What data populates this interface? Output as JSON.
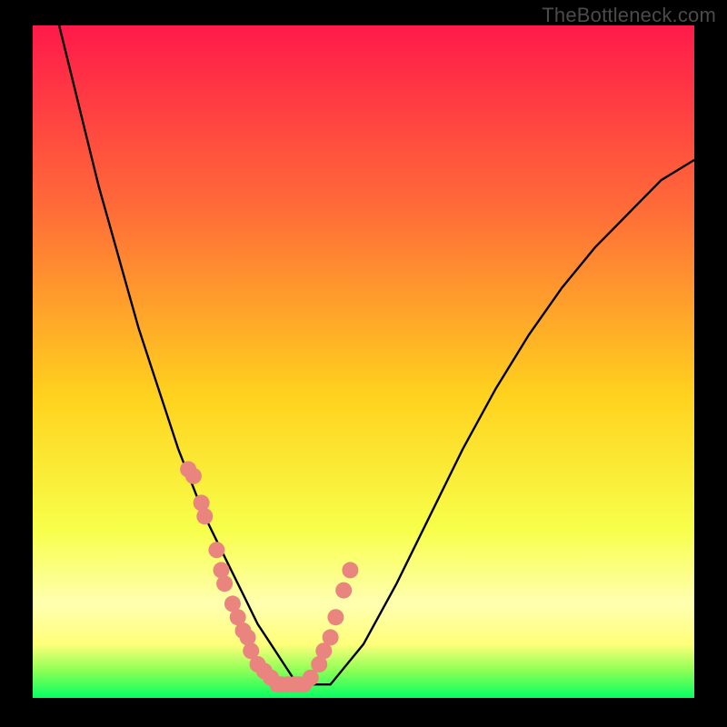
{
  "watermark": "TheBottleneck.com",
  "colors": {
    "frame": "#000000",
    "curve": "#000000",
    "dot_fill": "#e9847e",
    "grad_top": "#ff1a4a",
    "grad_mid_upper": "#ff6e38",
    "grad_mid": "#ffd21e",
    "grad_mid_lower": "#f7ff4a",
    "grad_band": "#ffffb0",
    "grad_bottom": "#05ff63"
  },
  "chart_data": {
    "type": "line",
    "title": "",
    "xlabel": "",
    "ylabel": "",
    "xlim": [
      0,
      100
    ],
    "ylim": [
      0,
      100
    ],
    "series": [
      {
        "name": "bottleneck-curve",
        "x": [
          4,
          6,
          8,
          10,
          12,
          14,
          16,
          18,
          20,
          22,
          24,
          26,
          28,
          30,
          32,
          34,
          36,
          38,
          40,
          45,
          50,
          55,
          60,
          65,
          70,
          75,
          80,
          85,
          90,
          95,
          100
        ],
        "y": [
          100,
          92,
          84,
          76,
          69,
          62,
          55,
          49,
          43,
          37,
          32,
          27,
          23,
          19,
          15,
          11,
          8,
          5,
          2,
          2,
          8,
          17,
          27,
          37,
          46,
          54,
          61,
          67,
          72,
          77,
          80
        ]
      }
    ],
    "dots": {
      "name": "highlight-range",
      "x": [
        23.5,
        24.3,
        25.5,
        26.0,
        27.8,
        28.5,
        29.0,
        30.2,
        31.0,
        31.8,
        32.5,
        33.0,
        34.0,
        35.0,
        36.0,
        37.0,
        37.5,
        38.5,
        39.5,
        40.2,
        41.0,
        42.0,
        43.3,
        44.0,
        45.0,
        45.8,
        47.0,
        48.0
      ],
      "y": [
        34,
        33,
        29,
        27,
        22,
        19,
        17,
        14,
        12,
        10,
        9,
        7,
        5,
        4,
        3,
        2,
        2,
        2,
        2,
        2,
        2,
        3,
        5,
        7,
        9,
        12,
        16,
        19
      ]
    }
  }
}
